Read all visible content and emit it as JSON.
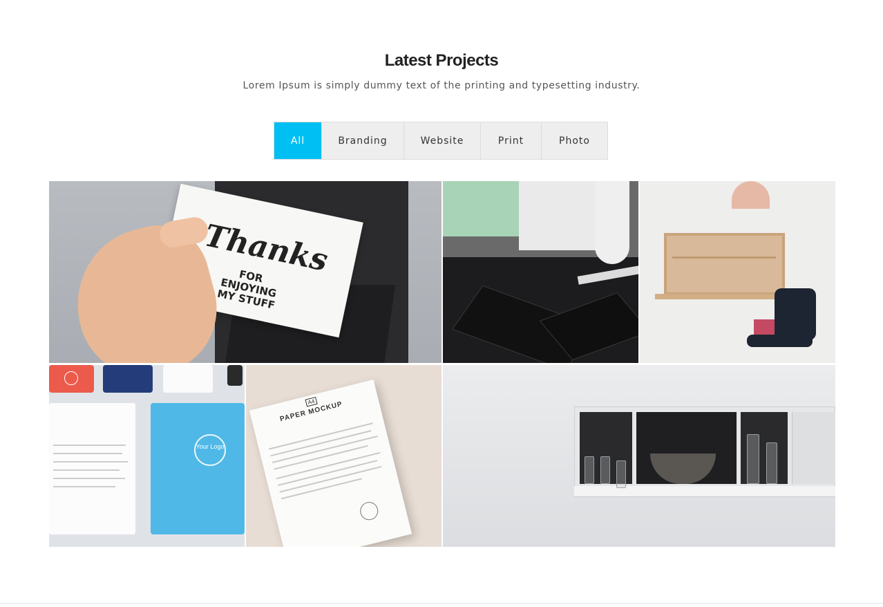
{
  "section": {
    "title": "Latest Projects",
    "subtitle": "Lorem Ipsum is simply dummy text of the printing and typesetting industry."
  },
  "filters": [
    {
      "label": "All",
      "active": true
    },
    {
      "label": "Branding",
      "active": false
    },
    {
      "label": "Website",
      "active": false
    },
    {
      "label": "Print",
      "active": false
    },
    {
      "label": "Photo",
      "active": false
    }
  ],
  "accent_color": "#00bff3",
  "portfolio": {
    "tile1": {
      "card_line1": "Thanks",
      "card_line2": "FOR",
      "card_line3": "ENJOYING",
      "card_line4": "MY STUFF"
    },
    "tile4": {
      "logo_text": "Your Logo"
    },
    "tile5": {
      "sheet_title": "PAPER MOCKUP",
      "sheet_badge": "A4"
    }
  }
}
